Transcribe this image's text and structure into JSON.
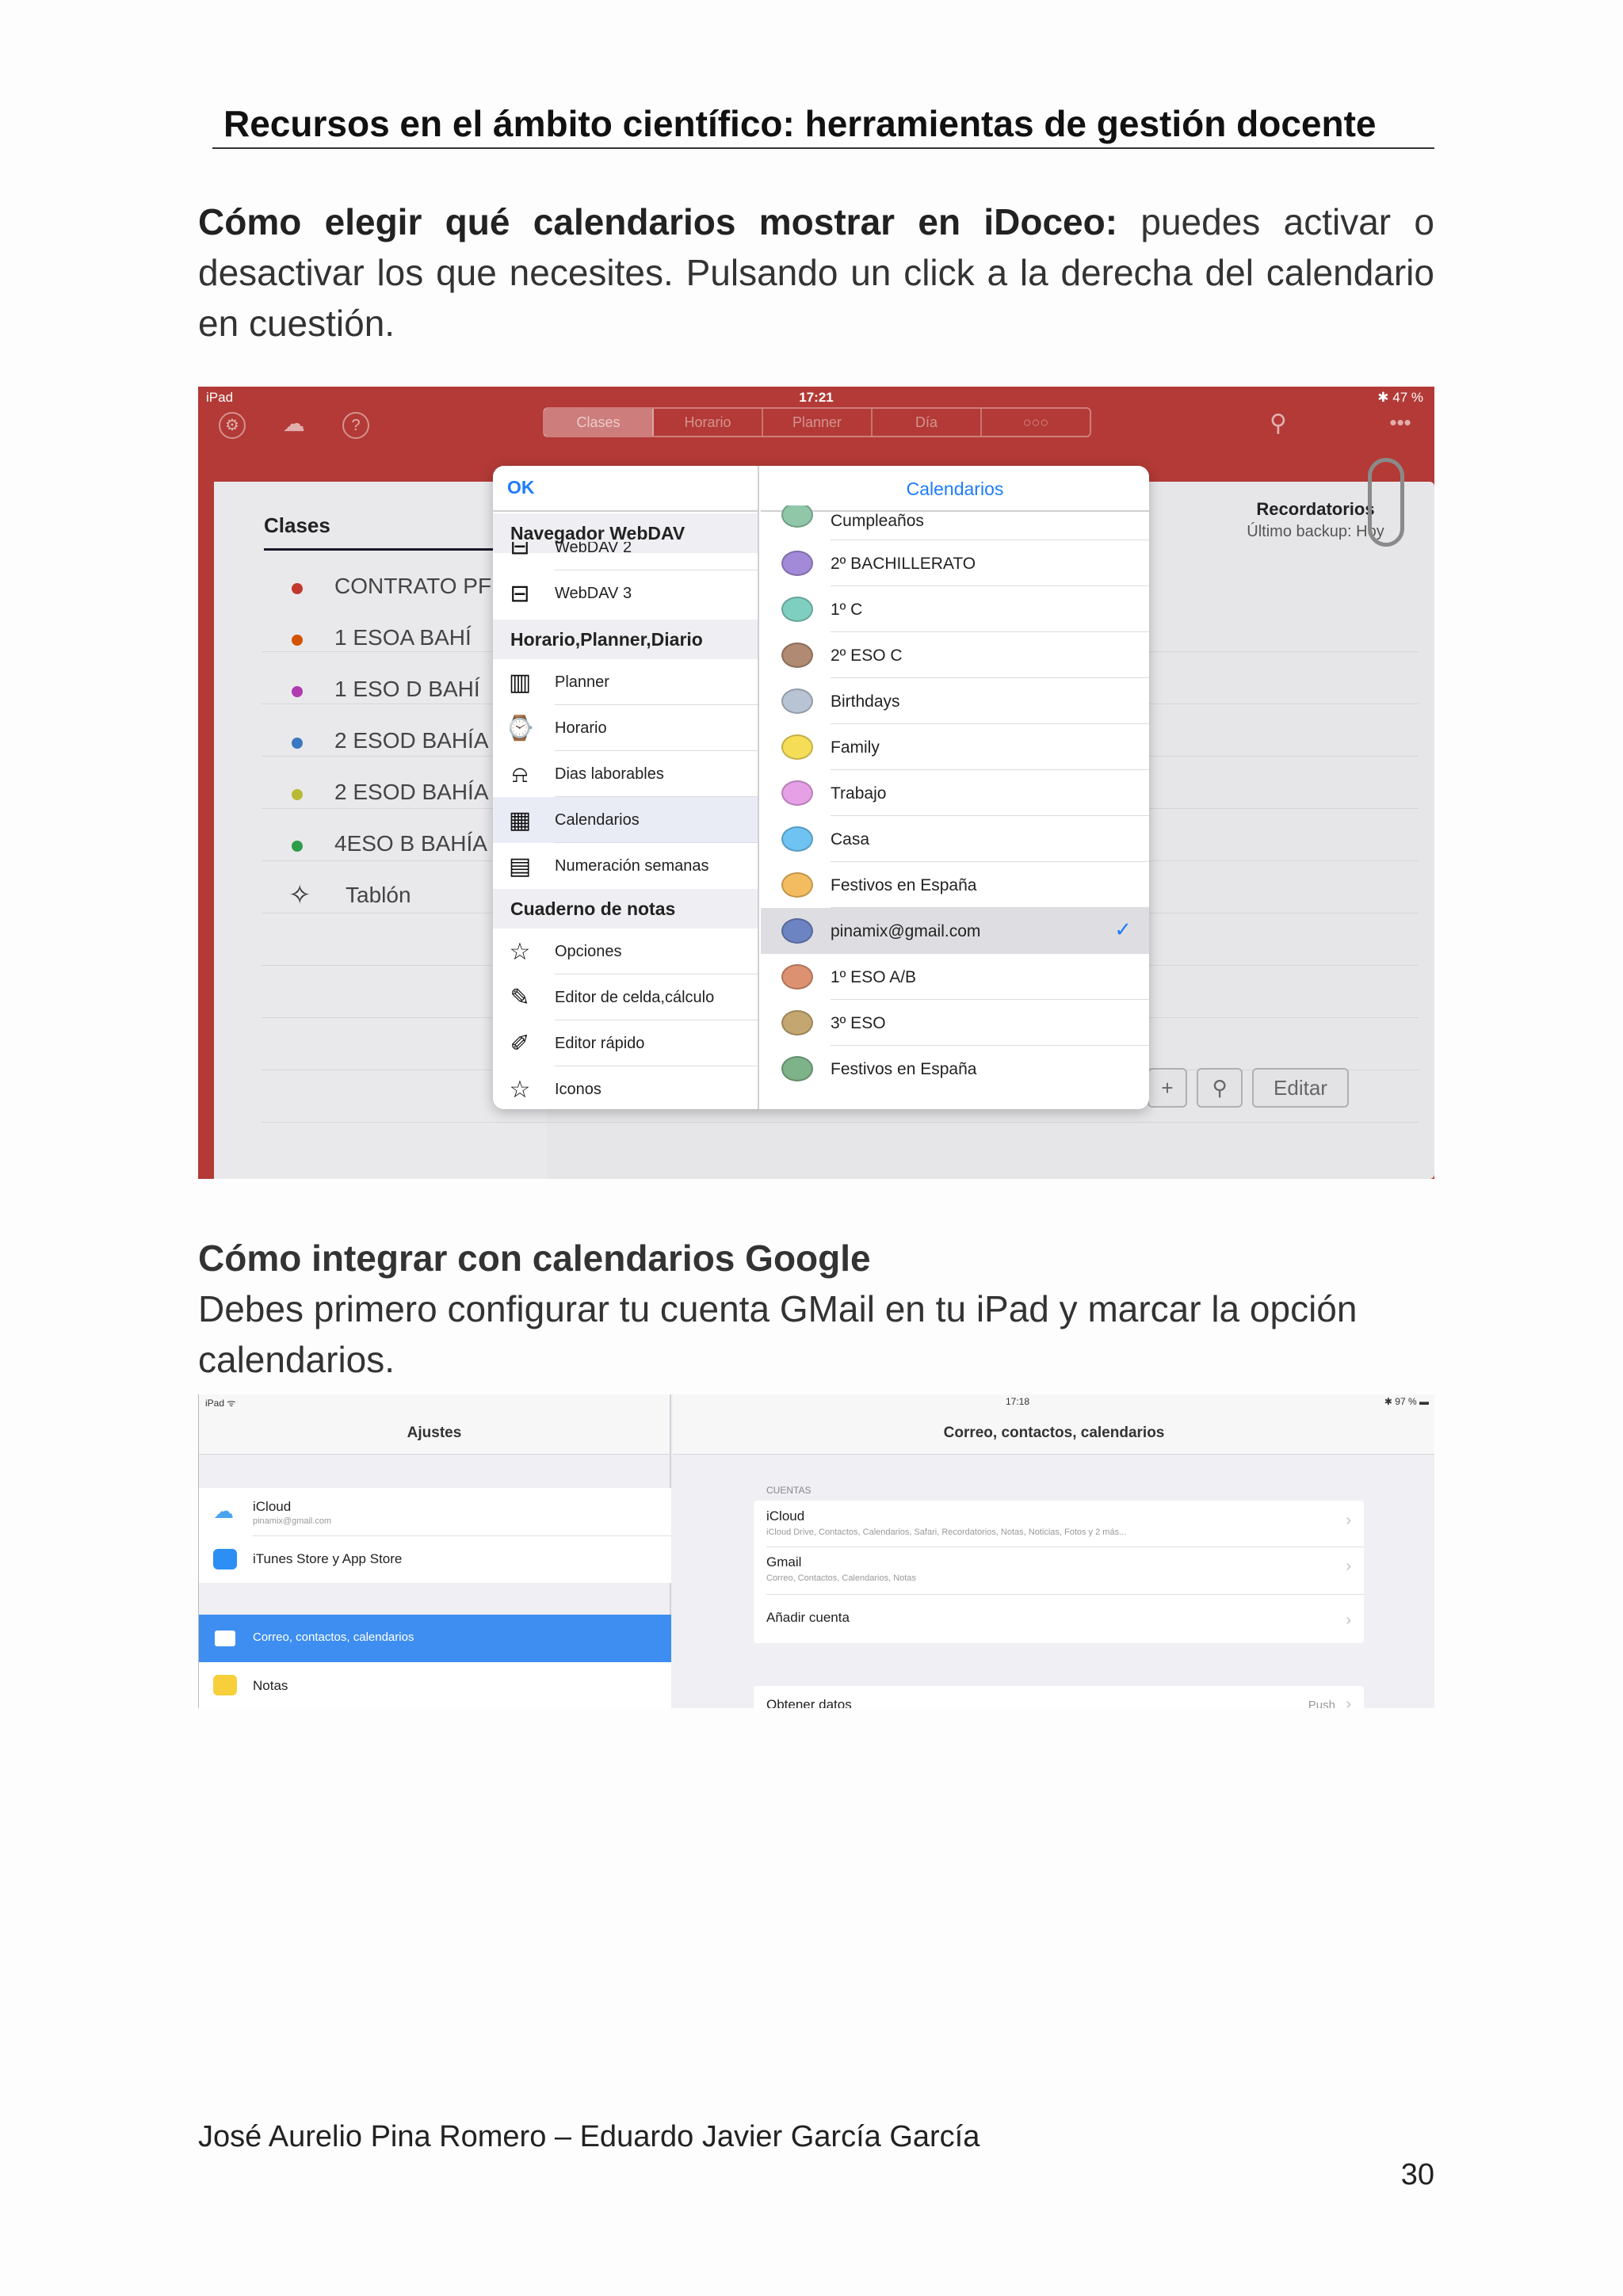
{
  "document": {
    "title": "Recursos en el ámbito científico: herramientas de gestión docente",
    "section1_bold": "Cómo elegir qué calendarios mostrar en iDoceo:",
    "section1_text": " puedes activar o desactivar los que necesites. Pulsando un click a la derecha del calendario en cuestión.",
    "section2_heading": "Cómo integrar con calendarios Google",
    "section2_text": "Debes primero configurar tu cuenta GMail en tu iPad y marcar la opción calendarios.",
    "footer_authors": "José Aurelio Pina Romero – Eduardo Javier García García",
    "page_number": "30"
  },
  "screenshot1": {
    "status": {
      "device": "iPad",
      "time": "17:21",
      "battery": "✱ 47 %"
    },
    "toolbar_segments": [
      "Clases",
      "Horario",
      "Planner",
      "Día",
      "○○○"
    ],
    "clases_heading": "Clases",
    "classes": [
      {
        "label": "CONTRATO PF",
        "color": "#c0392b"
      },
      {
        "label": "1 ESOA  BAHÍ",
        "color": "#d35400"
      },
      {
        "label": "1 ESO D BAHÍ",
        "color": "#b03ab0"
      },
      {
        "label": "2 ESOD BAHÍA",
        "color": "#3a78c0"
      },
      {
        "label": "2 ESOD BAHÍA",
        "color": "#b9b935"
      },
      {
        "label": "4ESO B BAHÍA",
        "color": "#2e9d4a"
      }
    ],
    "tablon": "Tablón",
    "recordatorios_title": "Recordatorios",
    "recordatorios_sub": "Último backup: Hoy",
    "buttons": {
      "add": "+",
      "search": "⚲",
      "edit": "Editar"
    },
    "popover": {
      "ok": "OK",
      "title": "Calendarios",
      "sections": [
        {
          "header": "Navegador WebDAV"
        },
        {
          "header": "Horario,Planner,Diario"
        },
        {
          "header": "Cuaderno de notas"
        }
      ],
      "webdav_items": [
        "WebDAV 2",
        "WebDAV 3"
      ],
      "hpd_items": [
        "Planner",
        "Horario",
        "Dias laborables",
        "Calendarios",
        "Numeración semanas"
      ],
      "notas_items": [
        "Opciones",
        "Editor de celda,cálculo",
        "Editor rápido",
        "Iconos"
      ],
      "calendars": [
        {
          "label": "Cumpleaños",
          "color": "#8fc7a8"
        },
        {
          "label": "2º BACHILLERATO",
          "color": "#a28ad8"
        },
        {
          "label": "1º C",
          "color": "#7fcfc0"
        },
        {
          "label": "2º ESO C",
          "color": "#b08a72"
        },
        {
          "label": "Birthdays",
          "color": "#b8c4d4"
        },
        {
          "label": "Family",
          "color": "#f6dd58"
        },
        {
          "label": "Trabajo",
          "color": "#e6a0e6"
        },
        {
          "label": "Casa",
          "color": "#6ec3f2"
        },
        {
          "label": "Festivos en España",
          "color": "#f4bc60"
        },
        {
          "label": "pinamix@gmail.com",
          "color": "#6c84c2",
          "checked": "✓"
        },
        {
          "label": "1º ESO A/B",
          "color": "#dc9270"
        },
        {
          "label": "3º ESO",
          "color": "#c4a770"
        },
        {
          "label": "Festivos en España",
          "color": "#7eb288"
        }
      ]
    }
  },
  "screenshot2": {
    "status": {
      "device": "iPad ᯤ",
      "time": "17:18",
      "battery": "✱ 97 % ▬"
    },
    "left_title": "Ajustes",
    "right_title": "Correo, contactos, calendarios",
    "left_rows": [
      {
        "label": "iCloud",
        "sub": "pinamix@gmail.com",
        "color": "#4aa3f0"
      },
      {
        "label": "iTunes Store y App Store",
        "color": "#2d8ef4"
      },
      {
        "label": "Correo, contactos, calendarios",
        "color": "#ffffff"
      },
      {
        "label": "Notas",
        "color": "#f6cf3a"
      }
    ],
    "cuentas_label": "CUENTAS",
    "accounts": [
      {
        "label": "iCloud",
        "sub": "iCloud Drive, Contactos, Calendarios, Safari, Recordatorios, Notas, Noticias, Fotos y 2 más..."
      },
      {
        "label": "Gmail",
        "sub": "Correo, Contactos, Calendarios, Notas"
      },
      {
        "label": "Añadir cuenta"
      }
    ],
    "fetch_label": "Obtener datos",
    "fetch_value": "Push",
    "chevron": "›"
  }
}
